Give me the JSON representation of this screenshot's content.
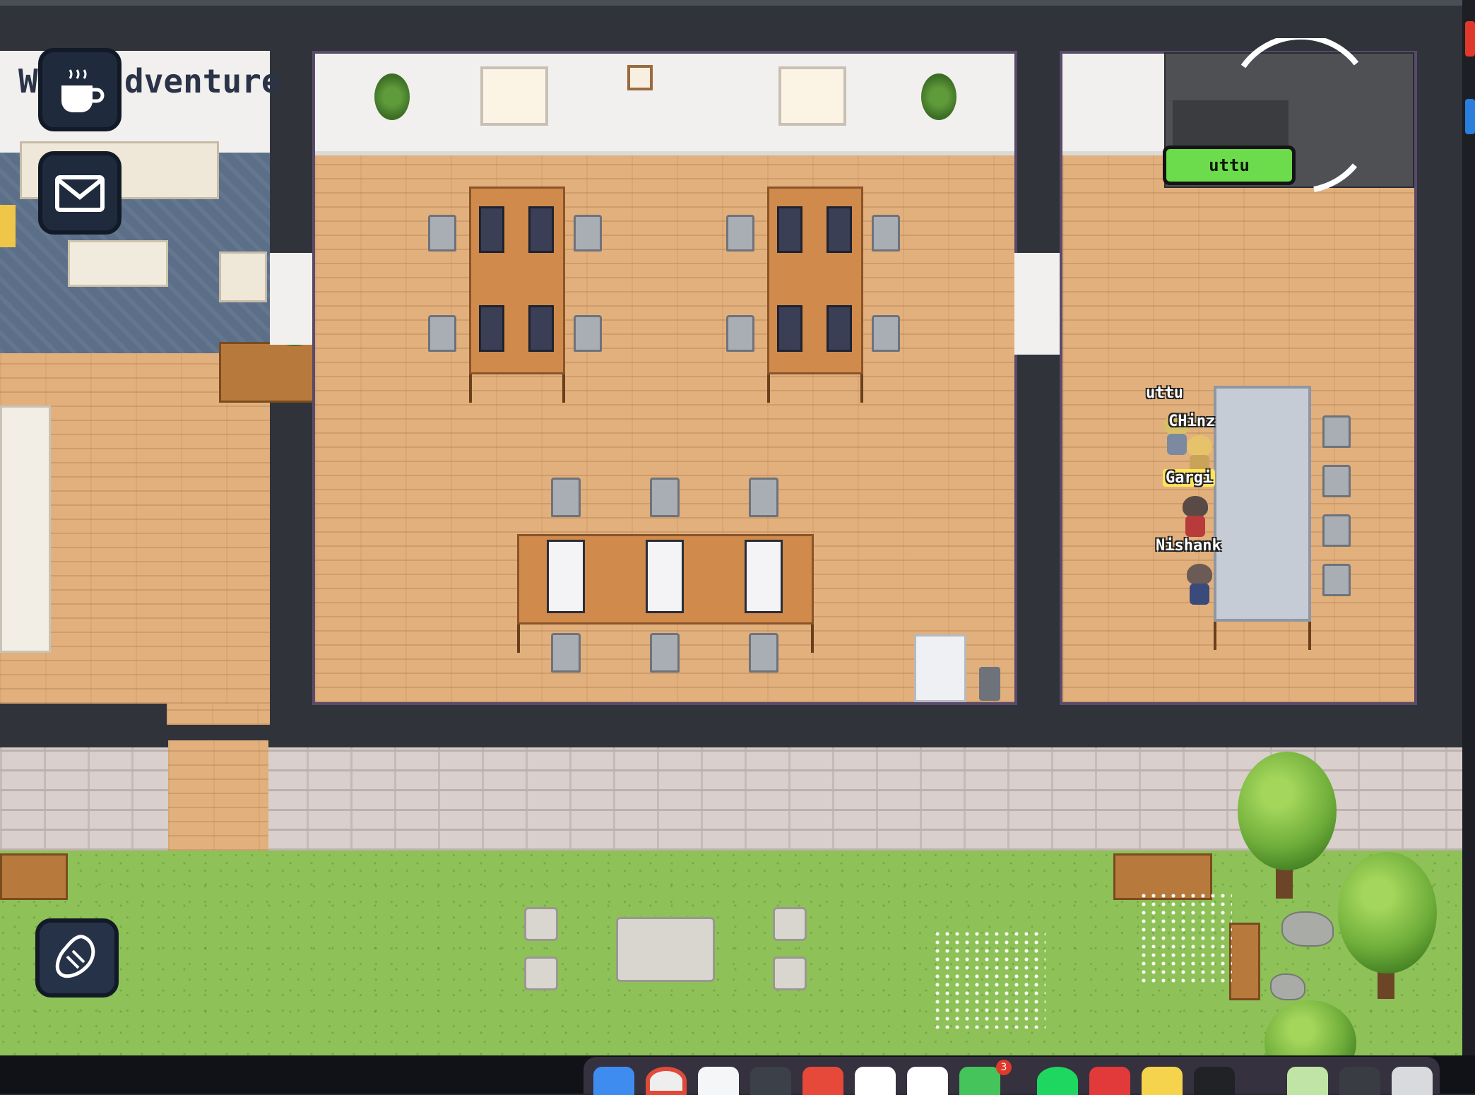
{
  "game": {
    "banner_fragment": "dventure",
    "banner_prefix": "W"
  },
  "hud": {
    "self_name_chip": "uttu",
    "buttons": [
      "coffee-icon",
      "mail-icon",
      "guitar-pick-icon"
    ]
  },
  "players": [
    {
      "name": "uttu",
      "highlighted": false
    },
    {
      "name": "CHinz",
      "highlighted": false
    },
    {
      "name": "Gargi",
      "highlighted": true
    },
    {
      "name": "Nishank",
      "highlighted": false
    }
  ],
  "dock": {
    "apps": [
      "finder",
      "chrome",
      "vscode",
      "paw",
      "todoist",
      "notion",
      "slack",
      "whatsapp",
      "spotify",
      "wps",
      "notes",
      "terminal",
      "preview",
      "finder-window",
      "trash"
    ],
    "whatsapp_badge": "3"
  },
  "colors": {
    "floor": "#e2b07c",
    "wall": "#30333a",
    "grass": "#8ec157",
    "name_chip": "#6cdc4c"
  }
}
